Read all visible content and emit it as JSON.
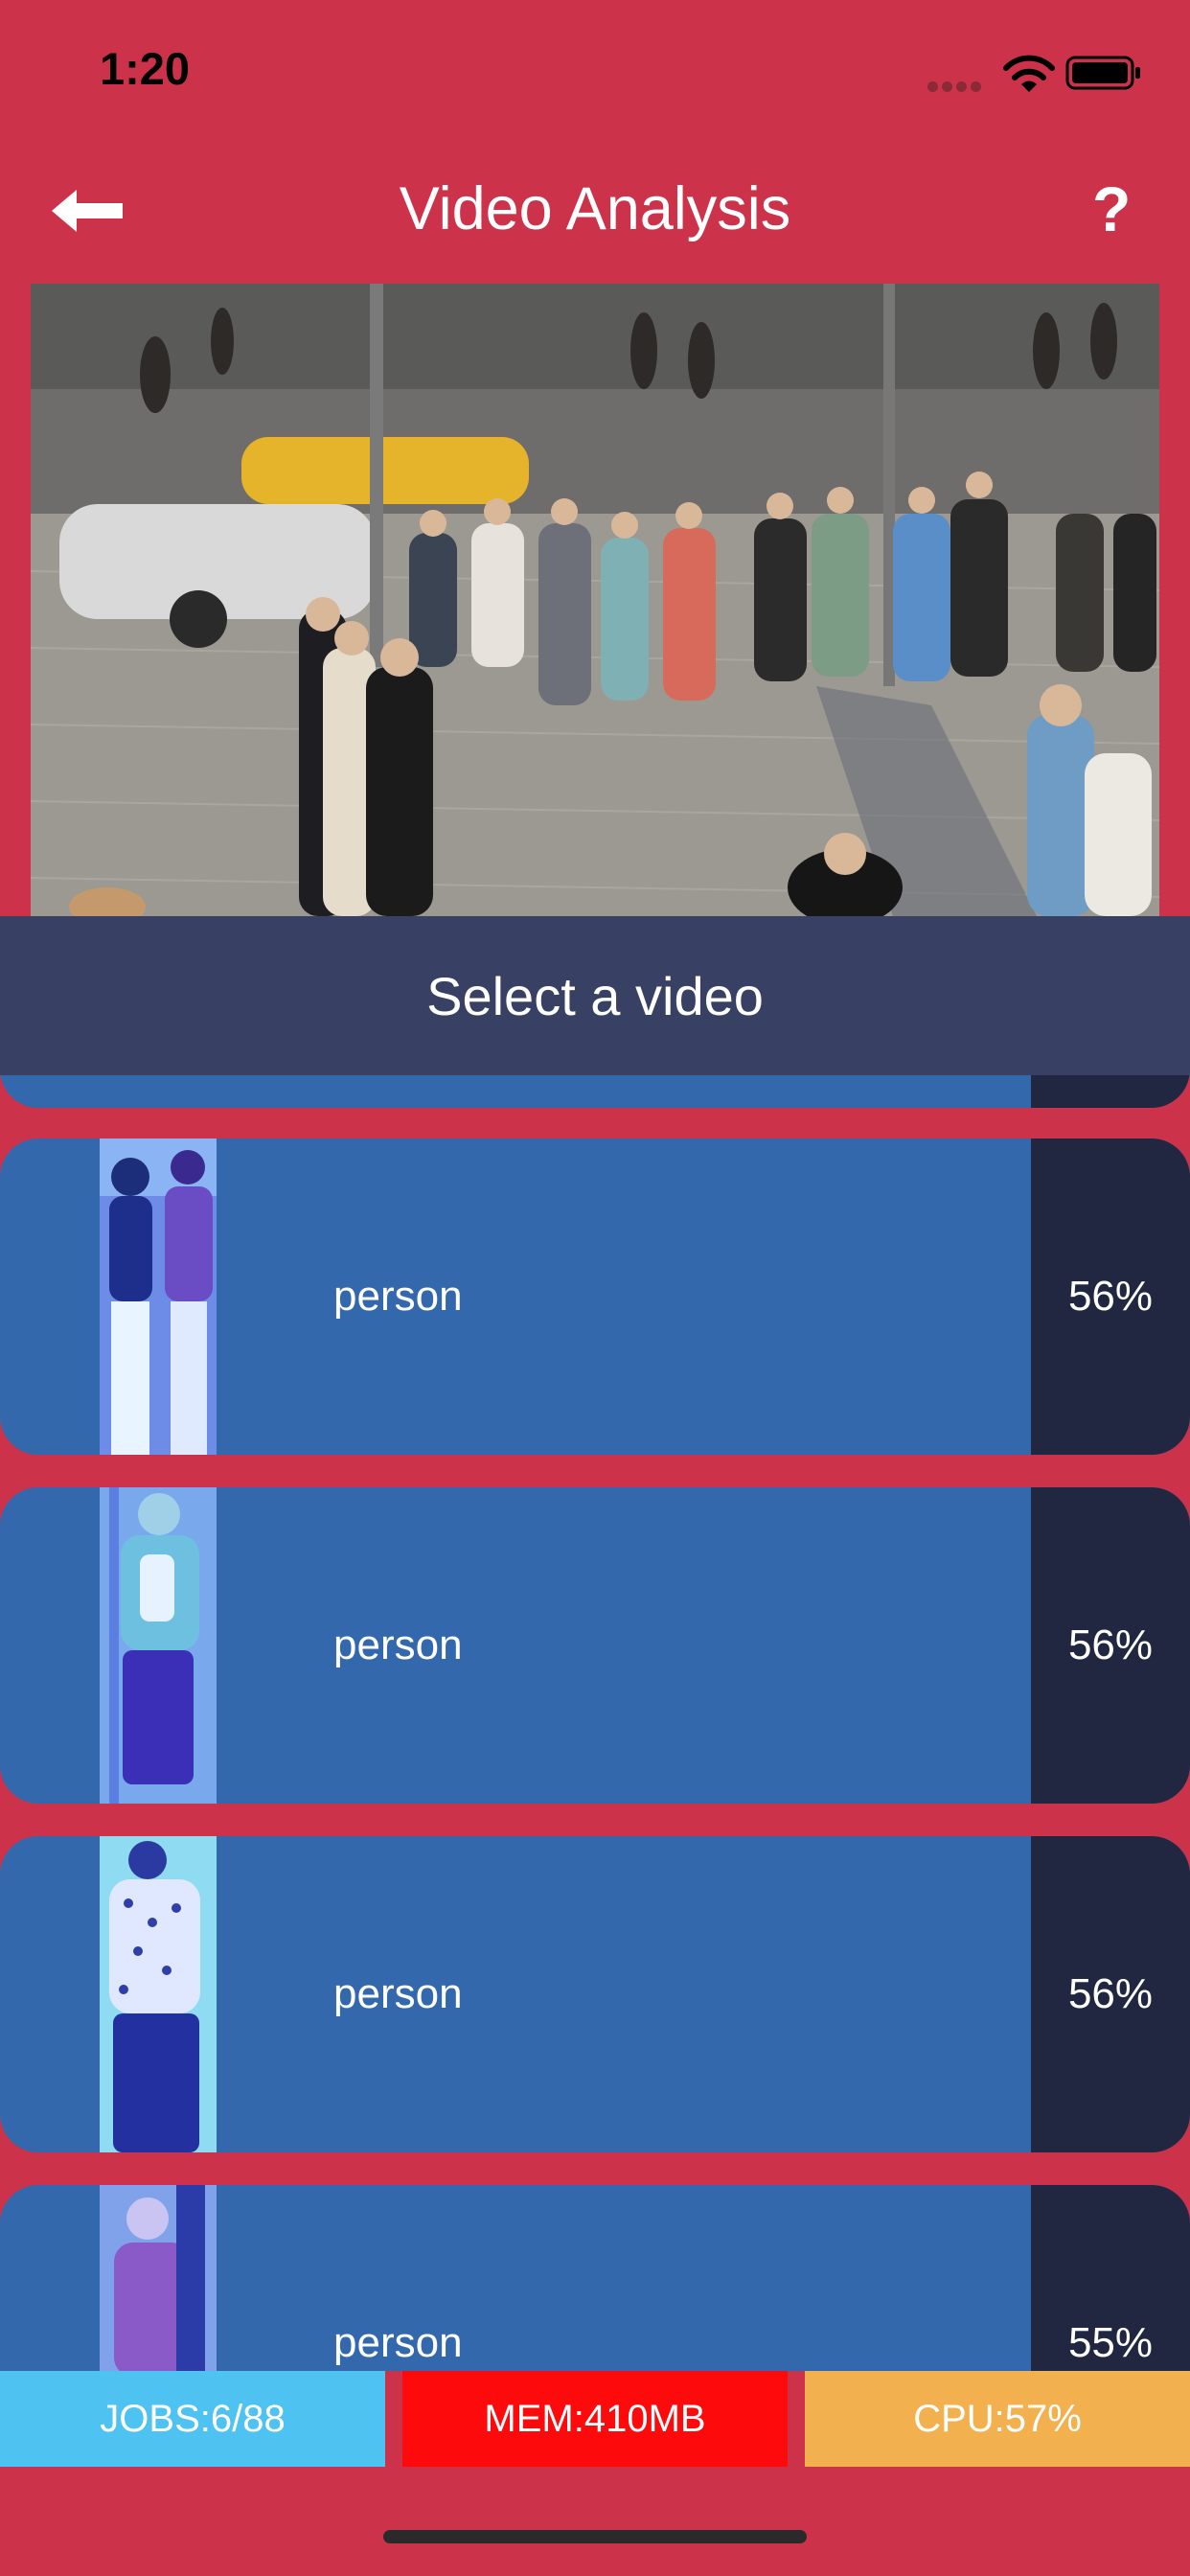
{
  "status_bar": {
    "time": "1:20"
  },
  "nav": {
    "title": "Video Analysis",
    "help_label": "?"
  },
  "select_video": {
    "label": "Select a video"
  },
  "detections": [
    {
      "label": "person",
      "confidence": "56%"
    },
    {
      "label": "person",
      "confidence": "56%"
    },
    {
      "label": "person",
      "confidence": "56%"
    },
    {
      "label": "person",
      "confidence": "55%"
    }
  ],
  "footer": {
    "jobs": "JOBS:6/88",
    "mem": "MEM:410MB",
    "cpu": "CPU:57%"
  },
  "colors": {
    "background": "#cc334b",
    "select_bar": "#384163",
    "card": "#3468ad",
    "card_confidence": "#212741",
    "jobs": "#4ec2f0",
    "mem": "#fc0a0c",
    "cpu": "#f2b04f"
  },
  "icons": {
    "back": "arrow-left-icon",
    "help": "question-icon",
    "wifi": "wifi-icon",
    "battery": "battery-icon"
  }
}
